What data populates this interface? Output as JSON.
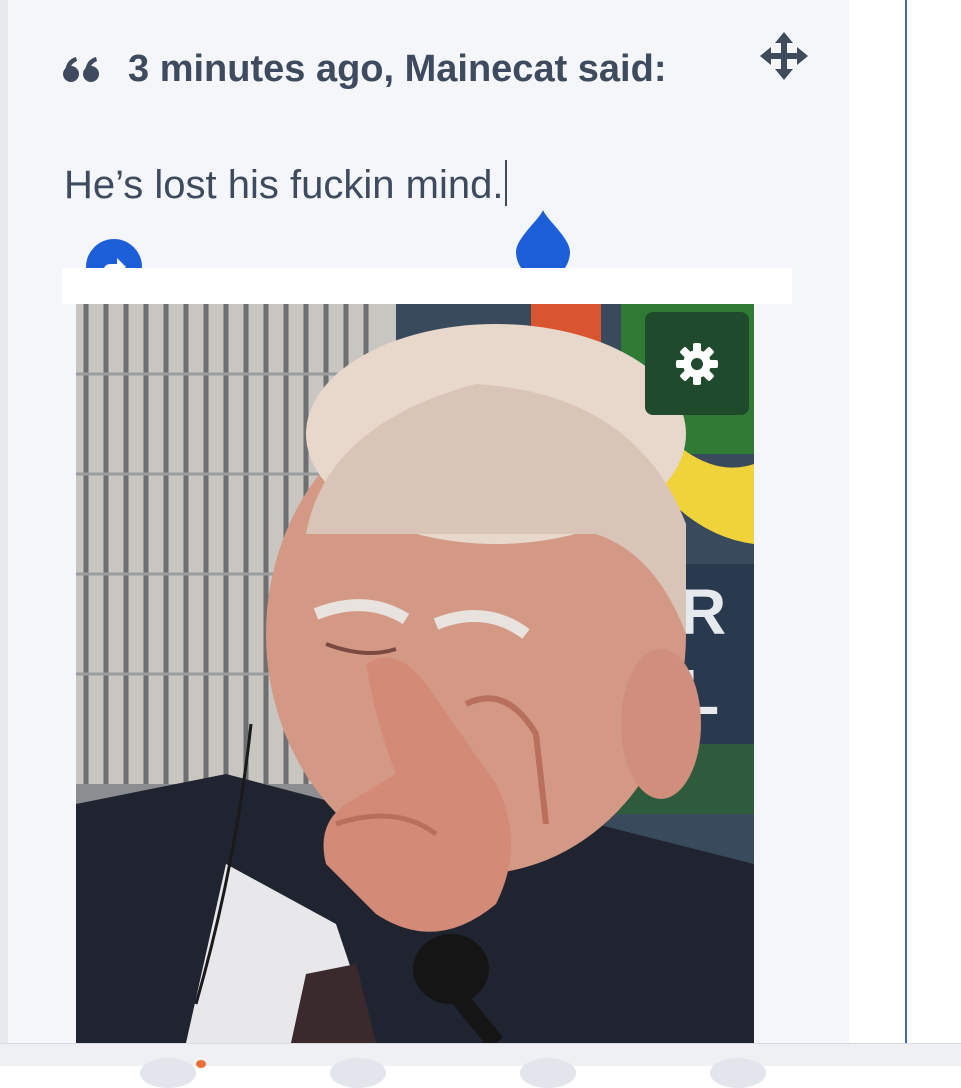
{
  "quote": {
    "author_line": "3 minutes ago, Mainecat said:",
    "text": "He’s lost his fuckin mind."
  },
  "icons": {
    "quote": "quote-icon",
    "move": "move-arrows-icon",
    "share": "share-arrow-icon",
    "settings": "gear-icon",
    "selection_handle": "text-selection-handle-icon"
  },
  "colors": {
    "panel_bg": "#f5f6fa",
    "text": "#3e4a5e",
    "accent_blue": "#1d5fd8",
    "settings_bg": "#1f4b2c",
    "divider": "#3d6bb3"
  }
}
